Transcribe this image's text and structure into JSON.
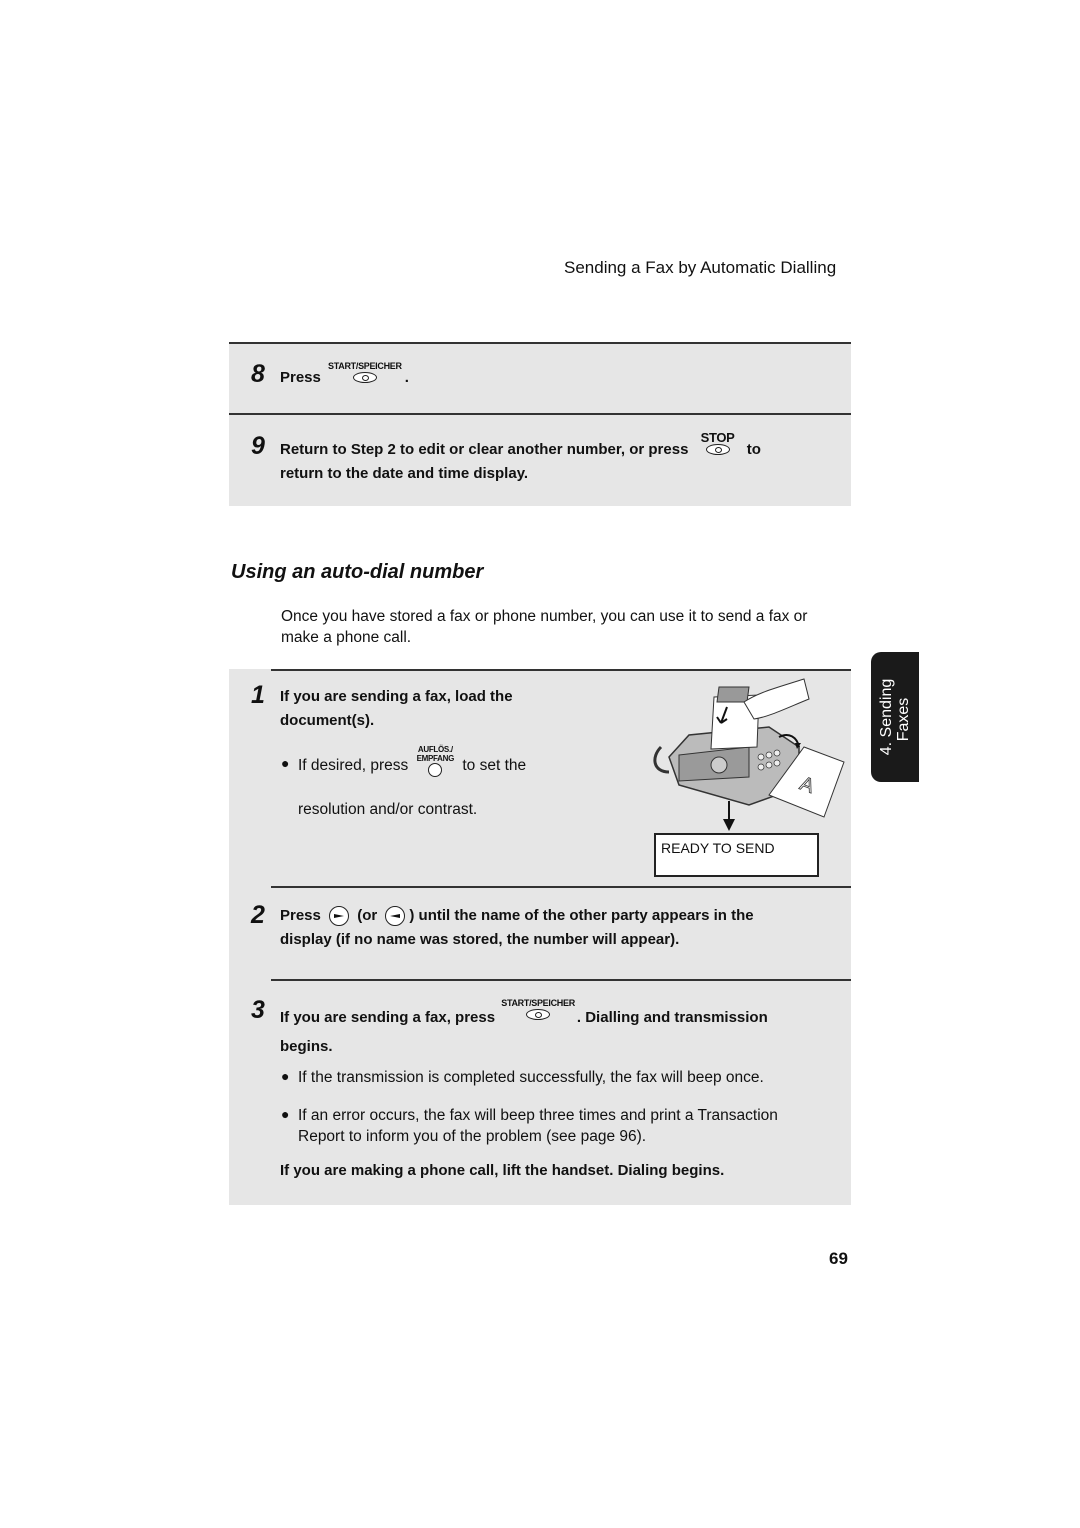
{
  "header": {
    "running_title": "Sending a Fax by Automatic Dialling"
  },
  "top_panel": {
    "step8": {
      "number": "8",
      "text_before": "Press",
      "button_label": "START/SPEICHER",
      "text_after": "."
    },
    "step9": {
      "number": "9",
      "line1_before": "Return to Step 2 to edit or clear another number, or press",
      "button_label": "STOP",
      "line1_after": "to",
      "line2": "return to the date and time display."
    }
  },
  "section": {
    "heading": "Using an auto-dial number",
    "intro_line1": "Once you have stored a fax or phone number, you can use it to send a fax or",
    "intro_line2": "make a phone call."
  },
  "steps": {
    "step1": {
      "number": "1",
      "line1": "If you are sending a fax, load the",
      "line2": "document(s).",
      "bullet_before": "If desired, press",
      "button_label_top": "AUFLÖS./",
      "button_label_bottom": "EMPFANG",
      "bullet_after": "to set the",
      "bullet_line2": "resolution and/or contrast."
    },
    "illustration": {
      "display_text": "READY TO SEND"
    },
    "step2": {
      "number": "2",
      "press": "Press",
      "or_text": "(or",
      "line1_after": ") until the name of the other party appears in the",
      "line2": "display (if no name was stored, the number will appear)."
    },
    "step3": {
      "number": "3",
      "line1_before": "If you are sending a fax, press",
      "button_label": "START/SPEICHER",
      "line1_after": ". Dialling and transmission",
      "line2": "begins.",
      "bullets": [
        {
          "line1": "If the transmission is completed successfully, the fax will beep once."
        },
        {
          "line1": "If an error occurs, the fax will beep three times and print a Transaction",
          "line2": "Report to inform you of the problem (see page 96)."
        }
      ],
      "phone_call_note": "If you are making a phone call, lift the handset. Dialing begins."
    }
  },
  "side_tab": {
    "line1": "4. Sending",
    "line2": "Faxes"
  },
  "footer": {
    "page_number": "69"
  }
}
